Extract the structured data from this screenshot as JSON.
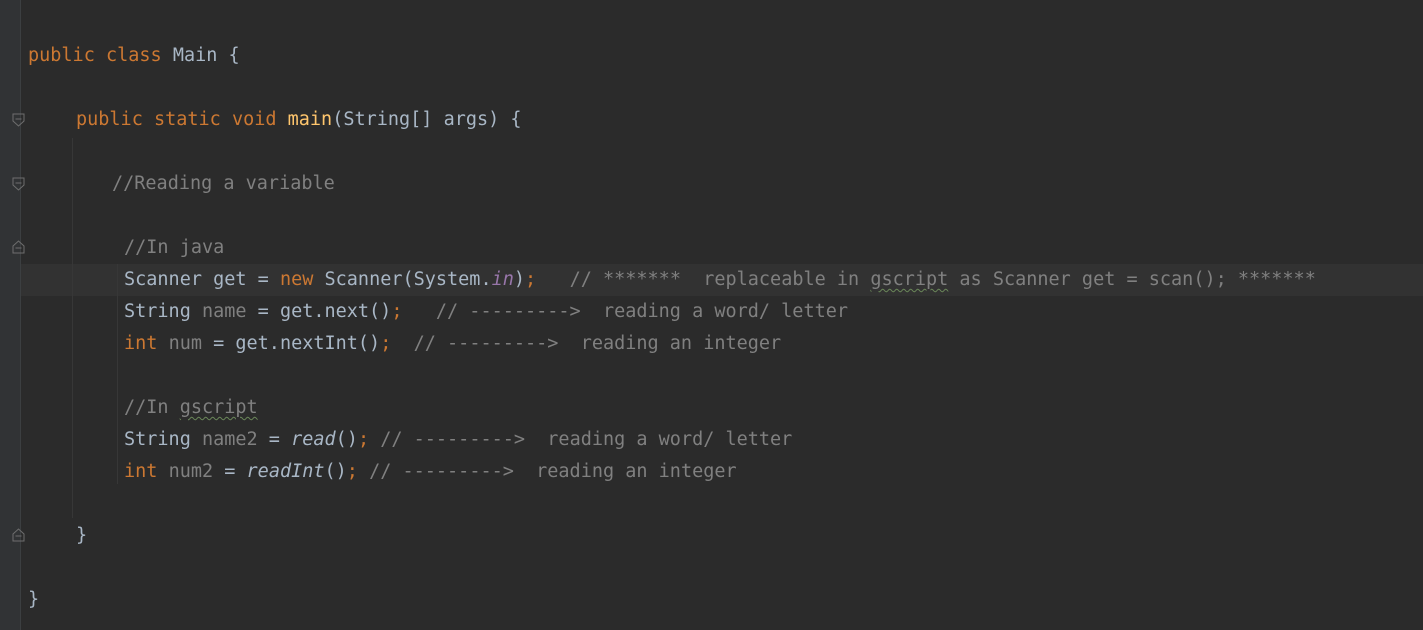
{
  "editor": {
    "language": "Java",
    "colors": {
      "background": "#2b2b2b",
      "keyword": "#cc7832",
      "method_declaration": "#ffc66d",
      "comment": "#808080",
      "static_field": "#9876aa",
      "default_text": "#a9b7c6",
      "caret_row": "#323232"
    },
    "gutter_icons": [
      "fold-icon",
      "fold-icon",
      "fold-end-icon",
      "fold-end-icon",
      "fold-end-icon"
    ],
    "lines": {
      "l1": {
        "kw1": "public",
        "kw2": "class",
        "name": "Main",
        "brace": "{"
      },
      "l2": {
        "kw1": "public",
        "kw2": "static",
        "kw3": "void",
        "fn": "main",
        "params": "(String[] args)",
        "brace": "{"
      },
      "l3": {
        "comment": "//Reading a variable"
      },
      "l4": {
        "comment": "//In java"
      },
      "l5": {
        "type": "Scanner",
        "var": "get",
        "eq": "=",
        "kw": "new",
        "ctor": "Scanner(System.",
        "field": "in",
        "close": ")",
        "semi": ";",
        "comment_a": "// *******  replaceable in ",
        "comment_typo": "gscript",
        "comment_b": " as Scanner get = scan(); *******"
      },
      "l6": {
        "type": "String",
        "var": "name",
        "expr": " = get.next()",
        "semi": ";",
        "comment": "// --------->  reading a word/ letter"
      },
      "l7": {
        "type": "int",
        "var": "num",
        "expr": " = get.nextInt()",
        "semi": ";",
        "comment": "// --------->  reading an integer"
      },
      "l8": {
        "comment_a": "//In ",
        "comment_typo": "gscript"
      },
      "l9": {
        "type": "String",
        "var": "name2",
        "eq": " = ",
        "call": "read",
        "paren": "()",
        "semi": ";",
        "comment": "// --------->  reading a word/ letter"
      },
      "l10": {
        "type": "int",
        "var": "num2",
        "eq": " = ",
        "call": "readInt",
        "paren": "()",
        "semi": ";",
        "comment": "// --------->  reading an integer"
      },
      "l11": {
        "brace": "}"
      },
      "l12": {
        "brace": "}"
      }
    }
  }
}
